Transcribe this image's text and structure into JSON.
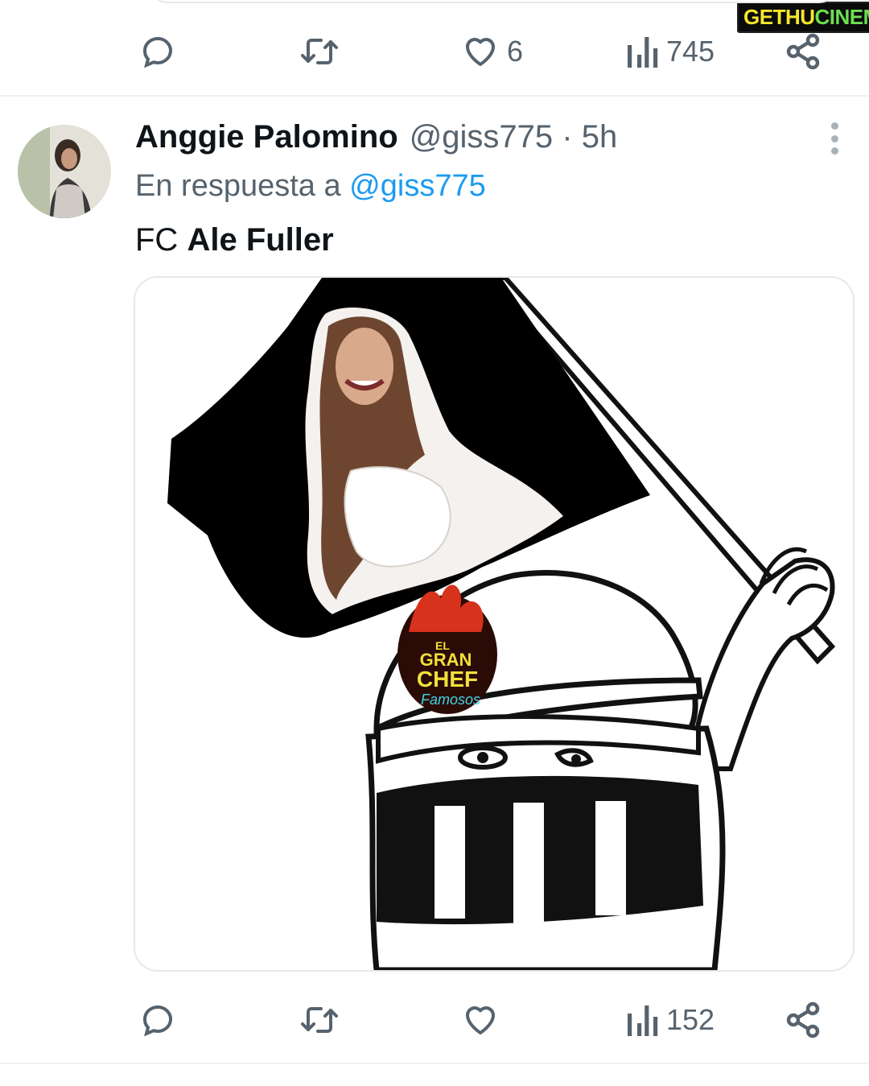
{
  "watermark": {
    "part_a": "GETHU",
    "part_b": "CINEMA"
  },
  "prev_tweet": {
    "actions": {
      "reply_count": "",
      "retweet_count": "",
      "like_count": "6",
      "views_count": "745"
    }
  },
  "tweet": {
    "author_name": "Anggie Palomino",
    "handle_time": "@giss775 · 5h",
    "reply_prefix": "En respuesta a",
    "reply_mention": "@giss775",
    "text_prefix": "FC",
    "text_bold": "Ale Fuller",
    "media": {
      "logo_line1": "EL",
      "logo_line2": "GRAN",
      "logo_line3": "CHEF",
      "logo_line4": "Famosos"
    },
    "actions": {
      "reply_count": "",
      "retweet_count": "",
      "like_count": "",
      "views_count": "152"
    }
  },
  "icons": {
    "reply": "reply-bubble-icon",
    "retweet": "retweet-icon",
    "like": "heart-icon",
    "views": "views-bar-chart-icon",
    "share": "share-icon",
    "more": "more-vertical-icon"
  }
}
